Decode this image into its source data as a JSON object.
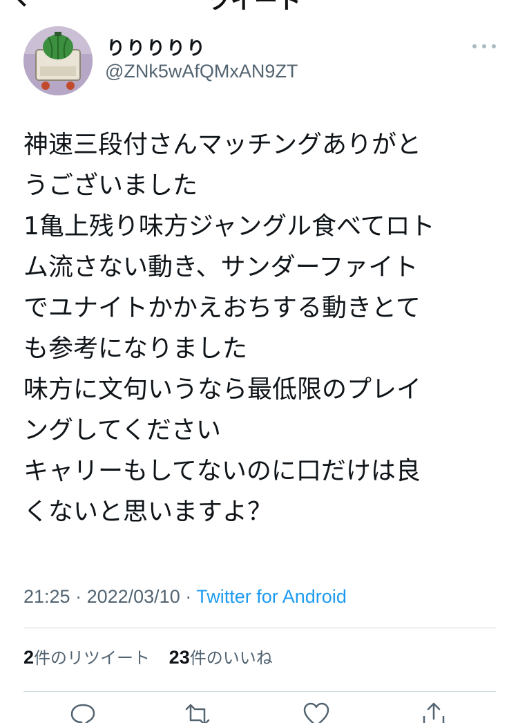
{
  "header": {
    "display_name": "りりりりり",
    "handle": "@ZNk5wAfQMxAN9ZT",
    "title_cut": "ツイート"
  },
  "tweet": {
    "lines": [
      "神速三段付さんマッチングありがと",
      "うございました",
      "1亀上残り味方ジャングル食べてロト",
      "ム流さない動き、サンダーファイト",
      "でユナイトかかえおちする動きとて",
      "も参考になりました",
      "味方に文句いうなら最低限のプレイ",
      "ングしてください",
      "キャリーもしてないのに口だけは良",
      "くないと思いますよ？"
    ]
  },
  "meta": {
    "time": "21:25",
    "separator": " · ",
    "date": "2022/03/10",
    "separator2": " · ",
    "source": "Twitter for Android"
  },
  "stats": {
    "retweet_count": "2",
    "retweet_label": "件のリツイート",
    "like_count": "23",
    "like_label": "件のいいね"
  },
  "icons": {
    "back": "back-chevron-icon",
    "more": "more-dots-icon",
    "reply": "reply-icon",
    "retweet": "retweet-icon",
    "like": "heart-icon",
    "share": "share-icon"
  },
  "colors": {
    "text": "#0f1419",
    "secondary": "#536471",
    "link": "#1d9bf0",
    "divider": "#cfd9de"
  }
}
